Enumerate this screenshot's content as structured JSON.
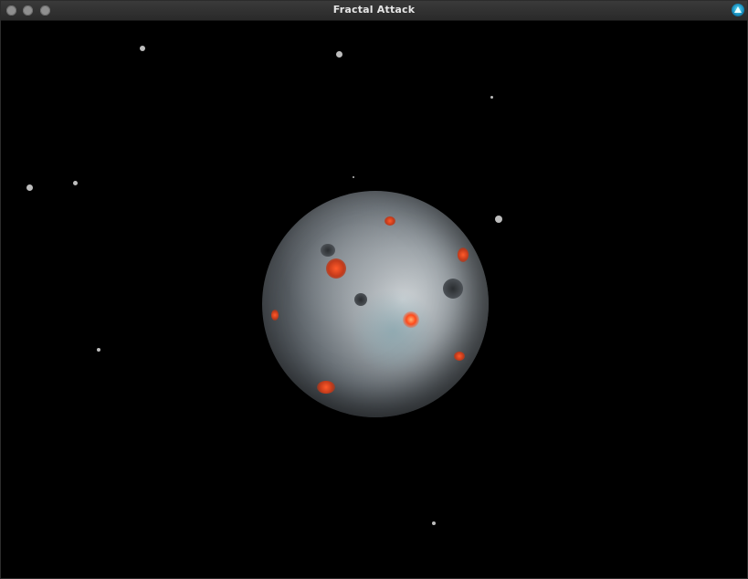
{
  "window": {
    "title": "Fractal Attack",
    "controls": [
      "close",
      "minimize",
      "maximize"
    ],
    "app_icon": "triangle-orb-icon"
  },
  "scene": {
    "background_color": "#000000",
    "planet_colors": {
      "rock": "#9ea5aa",
      "shadow": "#16181a",
      "ice": "#78a0aa",
      "lava": "#ff5a2a"
    },
    "asteroid_color": "#bdbdbd"
  }
}
